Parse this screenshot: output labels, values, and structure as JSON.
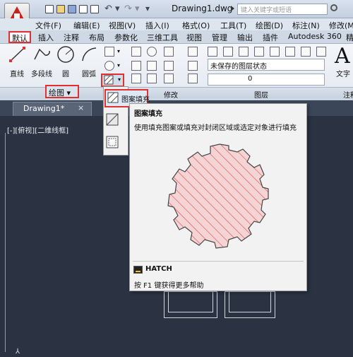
{
  "app": {
    "document_title": "Drawing1.dwg",
    "search_placeholder": "键入关键字或短语"
  },
  "menu": [
    "文件(F)",
    "编辑(E)",
    "视图(V)",
    "插入(I)",
    "格式(O)",
    "工具(T)",
    "绘图(D)",
    "标注(N)",
    "修改(M"
  ],
  "ribbon_tabs": [
    "默认",
    "插入",
    "注释",
    "布局",
    "参数化",
    "三维工具",
    "视图",
    "管理",
    "输出",
    "插件",
    "Autodesk 360",
    "精"
  ],
  "draw_panel": {
    "line": "直线",
    "polyline": "多段线",
    "circle": "圆",
    "arc": "圆弧",
    "footer_label": "绘图"
  },
  "modify_panel": {
    "footer_label": "修改"
  },
  "layers_panel": {
    "layer_state": "未保存的图层状态",
    "current_layer": "0",
    "footer_label": "图层"
  },
  "annotation_panel": {
    "text_label": "文字",
    "footer_label": "注释",
    "big_glyph": "A"
  },
  "hatch_menu": {
    "selected_label": "图案填充"
  },
  "doc_tab": {
    "name": "Drawing1*",
    "close": "×"
  },
  "viewport": {
    "label": "[-][俯视][二维线框]"
  },
  "tooltip": {
    "title": "图案填充",
    "description": "使用填充图案或填充对封闭区域或选定对象进行填充",
    "command": "HATCH",
    "help": "按 F1 键获得更多帮助"
  },
  "colors": {
    "accent_red": "#e03030",
    "hatch_red": "#e05a5a",
    "hatch_fill": "#f4d4d4",
    "canvas": "#2b3343"
  }
}
